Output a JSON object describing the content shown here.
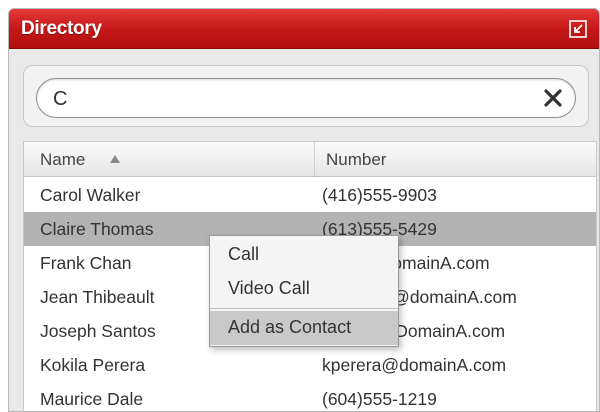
{
  "window": {
    "title": "Directory",
    "popout_icon": "popout-arrow-icon"
  },
  "search": {
    "value": "C",
    "clear_icon": "close-icon"
  },
  "table": {
    "columns": [
      "Name",
      "Number"
    ],
    "sort_icon": "sort-ascending-icon",
    "rows": [
      {
        "name": "Carol Walker",
        "number": "(416)555-9903"
      },
      {
        "name": "Claire Thomas",
        "number": "(613)555-5429"
      },
      {
        "name": "Frank Chan",
        "number": "fchan@domainA.com"
      },
      {
        "name": "Jean Thibeault",
        "number": "jthibeault@domainA.com"
      },
      {
        "name": "Joseph Santos",
        "number": "jsantos@DomainA.com"
      },
      {
        "name": "Kokila Perera",
        "number": "kperera@domainA.com"
      },
      {
        "name": "Maurice Dale",
        "number": "(604)555-1219"
      }
    ]
  },
  "context_menu": {
    "items": [
      "Call",
      "Video Call",
      "Add as Contact"
    ]
  },
  "colors": {
    "title_bar": "#c51818",
    "selected_row": "#b3b3b3",
    "menu_hover": "#c9c9c9"
  }
}
